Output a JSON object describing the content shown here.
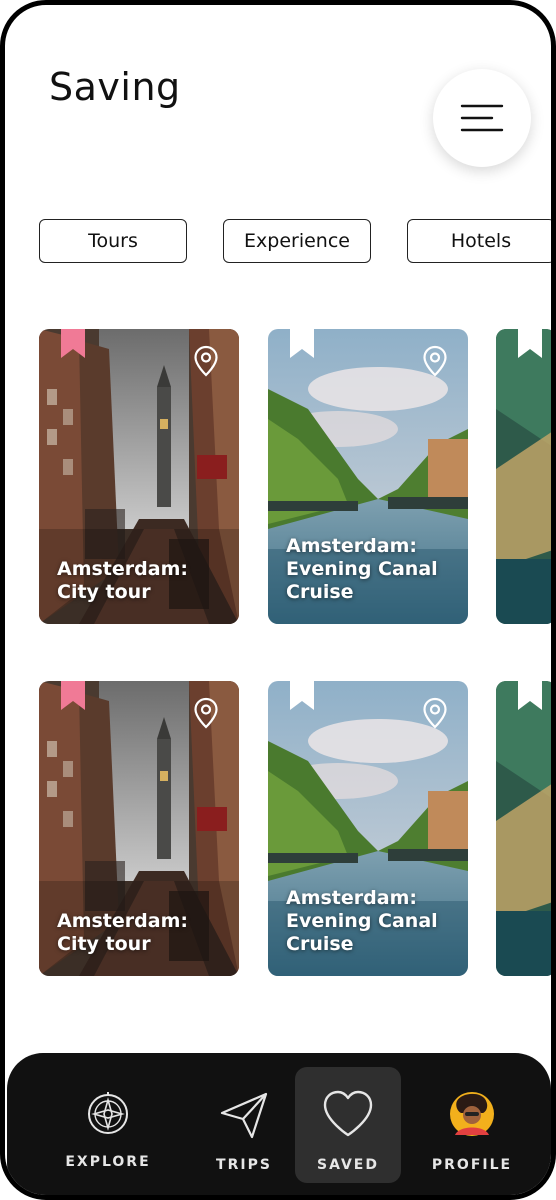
{
  "header": {
    "title": "Saving"
  },
  "menu": {
    "icon": "menu-icon"
  },
  "filters": [
    "Tours",
    "Experience",
    "Hotels"
  ],
  "cards": [
    {
      "title": "Amsterdam: City tour",
      "line1": "Amsterdam:",
      "line2": "City tour",
      "line3": "",
      "bookmarked": true,
      "bookmark_color": "#f07a96",
      "image": "street-image"
    },
    {
      "title": "Amsterdam: Evening Canal Cruise",
      "line1": "Amsterdam:",
      "line2": "Evening Canal",
      "line3": "Cruise",
      "bookmarked": false,
      "bookmark_color": "#ffffff",
      "image": "canal-image"
    },
    {
      "image": "palm-image"
    },
    {
      "title": "Amsterdam: City tour",
      "line1": "Amsterdam:",
      "line2": "City tour",
      "line3": "",
      "bookmarked": true,
      "bookmark_color": "#f07a96",
      "image": "street-image"
    },
    {
      "title": "Amsterdam: Evening Canal Cruise",
      "line1": "Amsterdam:",
      "line2": "Evening Canal",
      "line3": "Cruise",
      "bookmarked": false,
      "bookmark_color": "#ffffff",
      "image": "canal-image"
    },
    {
      "image": "palm-image"
    }
  ],
  "nav": {
    "explore": "EXPLORE",
    "trips": "TRIPS",
    "saved": "SAVED",
    "profile": "PROFILE",
    "active": "saved",
    "bar_color": "#111111",
    "active_color": "#2f2f2f"
  }
}
